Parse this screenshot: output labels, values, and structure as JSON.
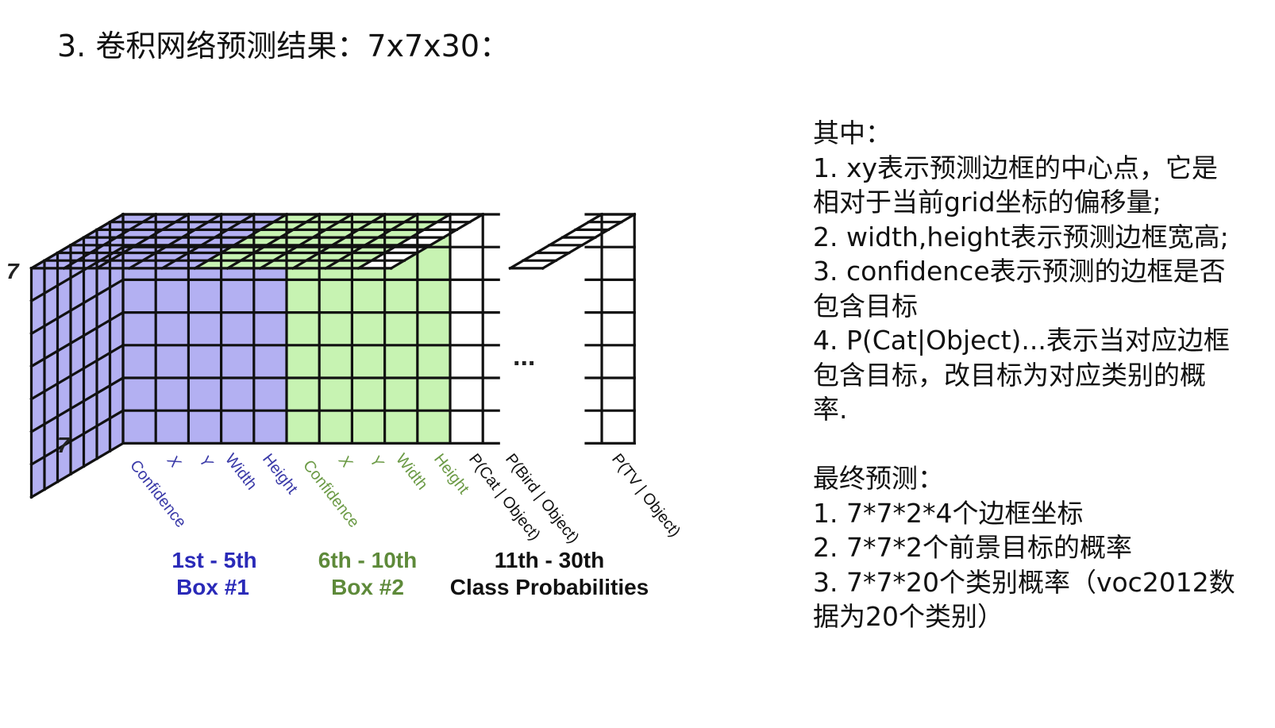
{
  "title": "3. 卷积网络预测结果：7x7x30：",
  "diagram": {
    "dim_height_label": "7",
    "dim_depth_label": "7",
    "ellipsis": "...",
    "channel_labels": {
      "box1": [
        "Confidence",
        "X",
        "Y",
        "Width",
        "Height"
      ],
      "box2": [
        "Confidence",
        "X",
        "Y",
        "Width",
        "Height"
      ],
      "classes": [
        "P(Cat | Object)",
        "P(Bird | Object)",
        "P(TV | Object)"
      ]
    },
    "groups": [
      {
        "range": "1st - 5th",
        "name": "Box #1",
        "color": "#2a2ab8"
      },
      {
        "range": "6th - 10th",
        "name": "Box #2",
        "color": "#5e8a3a"
      },
      {
        "range": "11th - 30th",
        "name": "Class Probabilities",
        "color": "#111111"
      }
    ],
    "colors": {
      "box1_fill": "#b3b0f2",
      "box2_fill": "#c7f3b2",
      "class_fill": "#ffffff",
      "grid_line": "#111111",
      "box1_label": "#3a3aa8",
      "box2_label": "#6b9a45"
    }
  },
  "explanation": {
    "heading": "其中：",
    "items": [
      [
        "1. xy表示预测边框的中心点，它是",
        "相对于当前grid坐标的偏移量;"
      ],
      [
        "2. width,height表示预测边框宽高;"
      ],
      [
        "3. confidence表示预测的边框是否",
        "包含目标"
      ],
      [
        "4. P(Cat|Object)...表示当对应边框",
        "包含目标，改目标为对应类别的概",
        "率."
      ]
    ],
    "final_heading": "最终预测：",
    "final_items": [
      "1. 7*7*2*4个边框坐标",
      "2. 7*7*2个前景目标的概率",
      "3. 7*7*20个类别概率（voc2012数",
      "据为20个类别）"
    ]
  }
}
